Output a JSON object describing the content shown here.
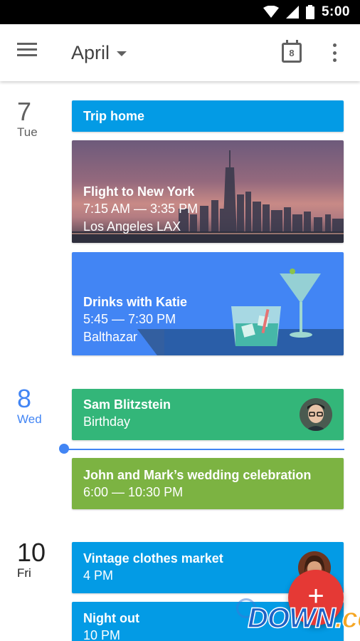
{
  "status_bar": {
    "time": "5:00"
  },
  "app_bar": {
    "month": "April",
    "today_date": "8"
  },
  "days": [
    {
      "num": "7",
      "name": "Tue"
    },
    {
      "num": "8",
      "name": "Wed"
    },
    {
      "num": "10",
      "name": "Fri"
    }
  ],
  "events": {
    "trip": {
      "title": "Trip home"
    },
    "flight": {
      "title": "Flight to New York",
      "time": "7:15 AM — 3:35 PM",
      "location": "Los Angeles LAX"
    },
    "drinks": {
      "title": "Drinks with Katie",
      "time": "5:45 — 7:30 PM",
      "location": "Balthazar"
    },
    "sam": {
      "title": "Sam Blitzstein",
      "subtitle": "Birthday"
    },
    "wedding": {
      "title": "John and Mark’s wedding celebration",
      "time": "6:00 — 10:30 PM"
    },
    "vintage": {
      "title": "Vintage clothes market",
      "time": "4 PM"
    },
    "night": {
      "title": "Night out",
      "time": "10 PM"
    }
  },
  "fab": {
    "icon": "+"
  },
  "watermark": {
    "main": "DOWN",
    "suffix": ".cc"
  },
  "colors": {
    "today_accent": "#4285f4",
    "trip": "#039be5",
    "drinks": "#4285f4",
    "sam": "#33b679",
    "wedding": "#7cb342",
    "fab": "#e53935"
  },
  "icons": {
    "menu": "menu-icon",
    "dropdown": "caret-down-icon",
    "today": "calendar-today-icon",
    "more": "more-vert-icon",
    "wifi": "wifi-icon",
    "signal": "signal-icon",
    "battery": "battery-icon",
    "fab": "add-icon"
  }
}
